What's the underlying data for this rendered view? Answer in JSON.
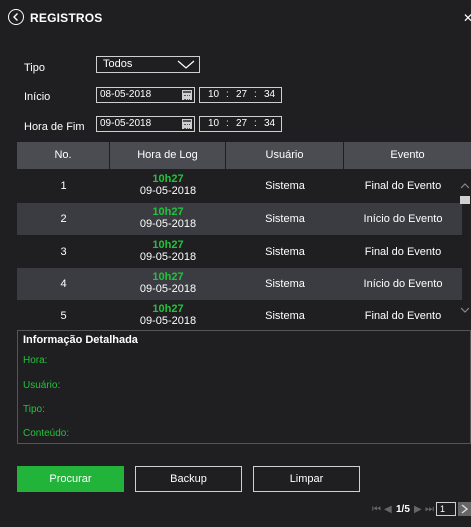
{
  "header": {
    "title": "REGISTROS"
  },
  "filters": {
    "type_label": "Tipo",
    "type_value": "Todos",
    "start_label": "Início",
    "start_date": "08-05-2018",
    "start_time": {
      "h": "10",
      "m": "27",
      "s": "34"
    },
    "end_label": "Hora de Fim",
    "end_date": "09-05-2018",
    "end_time": {
      "h": "10",
      "m": "27",
      "s": "34"
    }
  },
  "table": {
    "columns": [
      "No.",
      "Hora de Log",
      "Usuário",
      "Evento"
    ],
    "rows": [
      {
        "no": "1",
        "time": "10h27",
        "date": "09-05-2018",
        "user": "Sistema",
        "event": "Final do Evento"
      },
      {
        "no": "2",
        "time": "10h27",
        "date": "09-05-2018",
        "user": "Sistema",
        "event": "Início do Evento"
      },
      {
        "no": "3",
        "time": "10h27",
        "date": "09-05-2018",
        "user": "Sistema",
        "event": "Final do Evento"
      },
      {
        "no": "4",
        "time": "10h27",
        "date": "09-05-2018",
        "user": "Sistema",
        "event": "Início do Evento"
      },
      {
        "no": "5",
        "time": "10h27",
        "date": "09-05-2018",
        "user": "Sistema",
        "event": "Final do Evento"
      }
    ]
  },
  "detail": {
    "title": "Informação Detalhada",
    "hora": "Hora:",
    "usuario": "Usuário:",
    "tipo": "Tipo:",
    "conteudo": "Conteúdo:"
  },
  "buttons": {
    "search": "Procurar",
    "backup": "Backup",
    "clear": "Limpar"
  },
  "pager": {
    "page_text": "1/5",
    "page_input": "1"
  },
  "colors": {
    "accent": "#22b33a",
    "background": "#1f1f22",
    "header_row": "#4a4c52",
    "alt_row": "#3a3c41"
  }
}
